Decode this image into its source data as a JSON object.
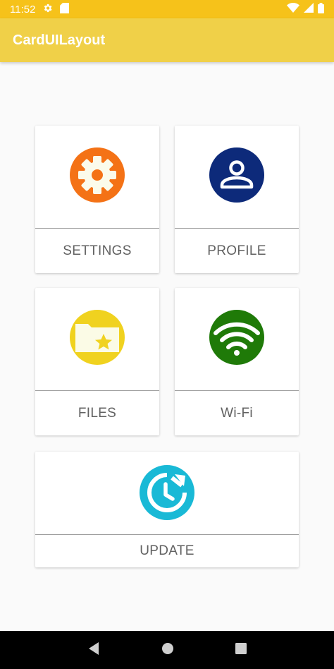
{
  "status_bar": {
    "time": "11:52",
    "icons": [
      "settings-icon",
      "sd-card-icon",
      "wifi-icon",
      "signal-icon",
      "battery-icon"
    ]
  },
  "app_bar": {
    "title": "CardUILayout"
  },
  "cards": {
    "settings": {
      "label": "SETTINGS",
      "icon": "gear-icon",
      "color": "#f47216"
    },
    "profile": {
      "label": "PROFILE",
      "icon": "person-icon",
      "color": "#0d2a7a"
    },
    "files": {
      "label": "FILES",
      "icon": "folder-star-icon",
      "color": "#f0d21f"
    },
    "wifi": {
      "label": "Wi-Fi",
      "icon": "wifi-icon",
      "color": "#1f7a08"
    },
    "update": {
      "label": "UPDATE",
      "icon": "update-clock-icon",
      "color": "#19b9d6"
    }
  },
  "nav_bar": {
    "icons": [
      "back-icon",
      "home-icon",
      "recents-icon"
    ]
  }
}
